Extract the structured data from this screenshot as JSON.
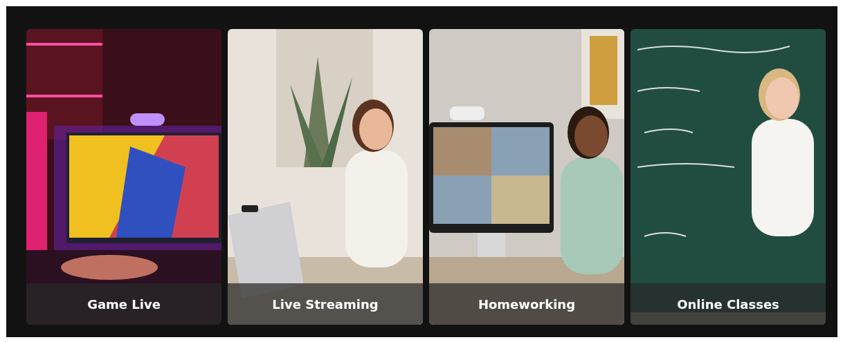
{
  "cards": [
    {
      "caption": "Game Live"
    },
    {
      "caption": "Live Streaming"
    },
    {
      "caption": "Homeworking"
    },
    {
      "caption": "Online Classes"
    }
  ]
}
